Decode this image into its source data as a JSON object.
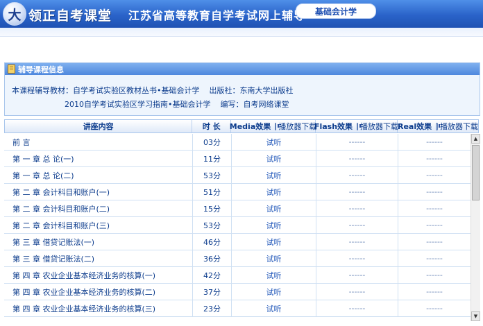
{
  "banner": {
    "logo_glyph": "大",
    "logo_text": "领正自考课堂",
    "title": "江苏省高等教育自学考试网上辅导",
    "course_pill": "基础会计学"
  },
  "panel": {
    "heading": "辅导课程信息",
    "line1_material": "本课程辅导教材：自学考试实验区教材丛书•基础会计学",
    "line1_publisher": "出版社：东南大学出版社",
    "line2_guide": "2010自学考试实验区学习指南•基础会计学",
    "line2_editor": "编写：自考网络课堂"
  },
  "table": {
    "headers": {
      "content": "讲座内容",
      "duration": "时 长",
      "media": "Media效果",
      "flash": "Flash效果",
      "real": "Real效果",
      "download": "播放器下载"
    },
    "listen_label": "试听",
    "na_label": "------",
    "rows": [
      {
        "title": "前    言",
        "duration": "03分"
      },
      {
        "title": "第 一 章   总 论(一)",
        "duration": "11分"
      },
      {
        "title": "第 一 章   总 论(二)",
        "duration": "53分"
      },
      {
        "title": "第 二 章   会计科目和账户(一)",
        "duration": "51分"
      },
      {
        "title": "第 二 章   会计科目和账户(二)",
        "duration": "15分"
      },
      {
        "title": "第 二 章   会计科目和账户(三)",
        "duration": "53分"
      },
      {
        "title": "第 三 章   借贷记账法(一)",
        "duration": "46分"
      },
      {
        "title": "第 三 章   借贷记账法(二)",
        "duration": "36分"
      },
      {
        "title": "第 四 章   农业企业基本经济业务的核算(一)",
        "duration": "42分"
      },
      {
        "title": "第 四 章   农业企业基本经济业务的核算(二)",
        "duration": "37分"
      },
      {
        "title": "第 四 章   农业企业基本经济业务的核算(三)",
        "duration": "23分"
      }
    ]
  },
  "scrollbar": {
    "up_arrow": "▲",
    "down_arrow": "▼"
  }
}
